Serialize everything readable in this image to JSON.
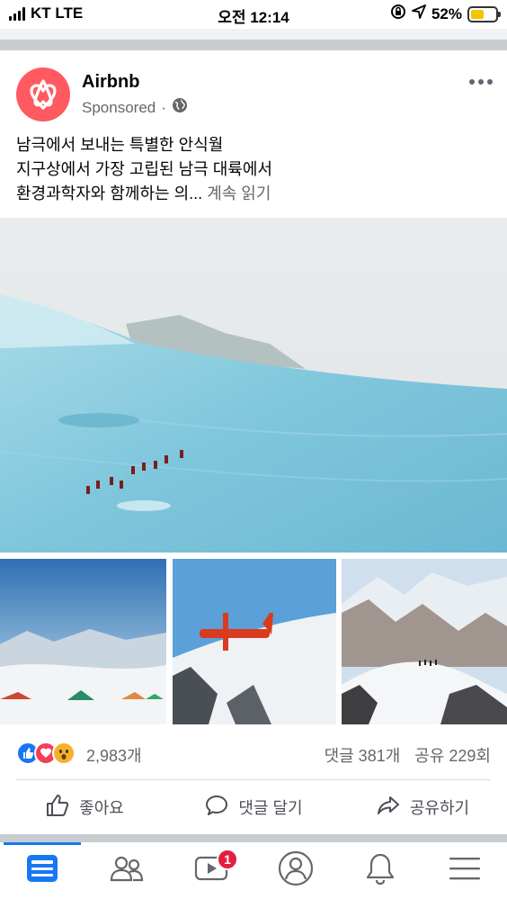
{
  "status_bar": {
    "carrier": "KT LTE",
    "time": "오전 12:14",
    "battery_percent": "52%",
    "battery_level": 0.52,
    "battery_color": "#f5c400"
  },
  "post": {
    "page_name": "Airbnb",
    "sponsored_label": "Sponsored",
    "separator": "·",
    "audience_icon": "globe-icon",
    "text_line1": "남극에서 보내는 특별한 안식월",
    "text_line2": "지구상에서 가장 고립된 남극 대륙에서",
    "text_line3": "환경과학자와 함께하는 의...",
    "see_more": "계속 읽기",
    "brand_color": "#ff5a5f"
  },
  "reactions": {
    "icons": [
      "like-reaction-icon",
      "love-reaction-icon",
      "wow-reaction-icon"
    ],
    "count": "2,983개",
    "comments": "댓글 381개",
    "shares": "공유 229회"
  },
  "actions": {
    "like": "좋아요",
    "comment": "댓글 달기",
    "share": "공유하기"
  },
  "tab_bar": {
    "accent": "#1877f2",
    "watch_badge": "1",
    "tabs": [
      "news-feed-icon",
      "friends-icon",
      "watch-icon",
      "profile-icon",
      "notifications-icon",
      "menu-icon"
    ]
  }
}
